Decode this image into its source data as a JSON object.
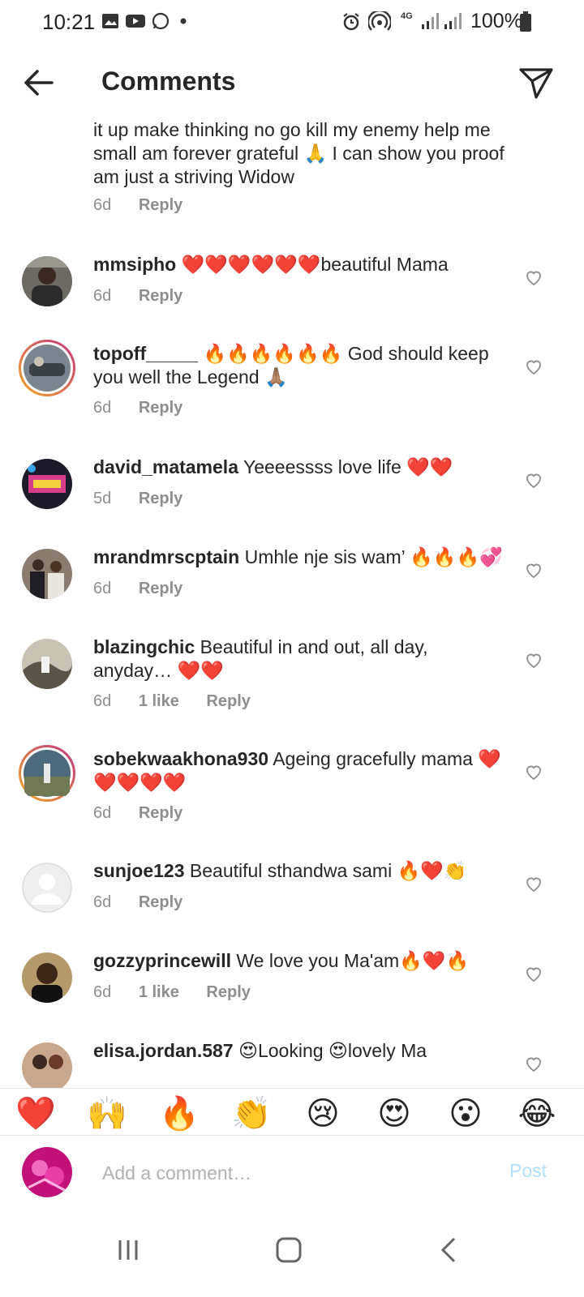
{
  "status_bar": {
    "time": "10:21",
    "network": "4G",
    "battery": "100%"
  },
  "header": {
    "title": "Comments"
  },
  "comments": [
    {
      "text": "it up make thinking no go kill my enemy help me small am forever grateful 🙏 I can show you proof am just a striving Widow",
      "time": "6d",
      "reply": "Reply"
    },
    {
      "username": "mmsipho",
      "text": "❤️❤️❤️❤️❤️❤️beautiful Mama",
      "time": "6d",
      "reply": "Reply"
    },
    {
      "username": "topoff_____",
      "text": "🔥🔥🔥🔥🔥🔥 God should keep you well the Legend 🙏🏽",
      "time": "6d",
      "reply": "Reply"
    },
    {
      "username": "david_matamela",
      "text": "Yeeeessss love life ❤️❤️",
      "time": "5d",
      "reply": "Reply"
    },
    {
      "username": "mrandmrscptain",
      "text": "Umhle nje sis wam’ 🔥🔥🔥💞",
      "time": "6d",
      "reply": "Reply"
    },
    {
      "username": "blazingchic",
      "text": "Beautiful in and out, all day, anyday… ❤️❤️",
      "time": "6d",
      "likes": "1 like",
      "reply": "Reply"
    },
    {
      "username": "sobekwaakhona930",
      "text": "Ageing gracefully mama ❤️❤️❤️❤️❤️",
      "time": "6d",
      "reply": "Reply"
    },
    {
      "username": "sunjoe123",
      "text": "Beautiful sthandwa sami 🔥❤️👏",
      "time": "6d",
      "reply": "Reply"
    },
    {
      "username": "gozzyprincewill",
      "text": "We love you Ma'am🔥❤️🔥",
      "time": "6d",
      "likes": "1 like",
      "reply": "Reply"
    },
    {
      "username": "elisa.jordan.587",
      "text": "😍Looking 😍lovely Ma"
    }
  ],
  "reactions": [
    "❤️",
    "🙌",
    "🔥",
    "👏",
    "😢",
    "😍",
    "😮",
    "😂"
  ],
  "composer": {
    "placeholder": "Add a comment…",
    "post_label": "Post"
  },
  "colors": {
    "text": "#262626",
    "meta": "#8e8e8e",
    "post_disabled": "#b2dffc",
    "story_ring": "#e1306c"
  }
}
